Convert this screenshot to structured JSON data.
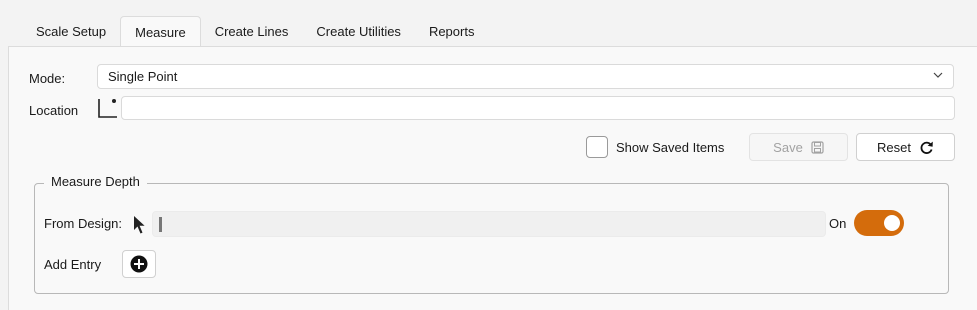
{
  "tabs": [
    {
      "label": "Scale Setup",
      "active": false
    },
    {
      "label": "Measure",
      "active": true
    },
    {
      "label": "Create Lines",
      "active": false
    },
    {
      "label": "Create Utilities",
      "active": false
    },
    {
      "label": "Reports",
      "active": false
    }
  ],
  "form": {
    "mode_label": "Mode:",
    "mode_value": "Single Point",
    "location_label": "Location",
    "location_value": "",
    "show_saved_label": "Show Saved Items",
    "show_saved_checked": false,
    "save_label": "Save",
    "reset_label": "Reset"
  },
  "measure_depth": {
    "legend": "Measure Depth",
    "from_design_label": "From Design:",
    "from_design_value": "",
    "toggle_label": "On",
    "toggle_on": true,
    "add_entry_label": "Add Entry"
  },
  "colors": {
    "accent": "#d46c0c",
    "disabled_text": "#a2a2a2"
  }
}
